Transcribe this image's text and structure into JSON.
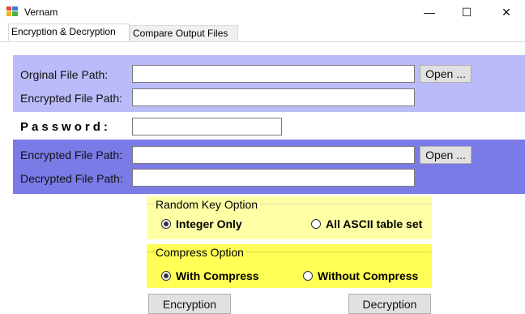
{
  "window": {
    "title": "Vernam",
    "minimize_glyph": "—",
    "maximize_glyph": "☐",
    "close_glyph": "✕"
  },
  "tabs": [
    {
      "label": "Encryption & Decryption",
      "active": true
    },
    {
      "label": "Compare Output Files",
      "active": false
    }
  ],
  "encrypt_section": {
    "original_label": "Orginal File Path:",
    "original_value": "",
    "encrypted_label": "Encrypted File Path:",
    "encrypted_value": "",
    "open_button": "Open ..."
  },
  "password": {
    "label": "Password:",
    "value": ""
  },
  "decrypt_section": {
    "encrypted_label": "Encrypted File Path:",
    "encrypted_value": "",
    "decrypted_label": "Decrypted File Path:",
    "decrypted_value": "",
    "open_button": "Open ..."
  },
  "random_key_option": {
    "title": "Random Key Option",
    "options": [
      {
        "label": "Integer Only",
        "selected": true
      },
      {
        "label": "All ASCII table set",
        "selected": false
      }
    ]
  },
  "compress_option": {
    "title": "Compress Option",
    "options": [
      {
        "label": "With Compress",
        "selected": true
      },
      {
        "label": "Without Compress",
        "selected": false
      }
    ]
  },
  "actions": {
    "encryption_button": "Encryption",
    "decryption_button": "Decryption"
  },
  "colors": {
    "encrypt_panel": "#bbbbf9",
    "decrypt_panel": "#7b7be8",
    "random_key_group": "#ffffa6",
    "compress_group": "#ffff55"
  }
}
